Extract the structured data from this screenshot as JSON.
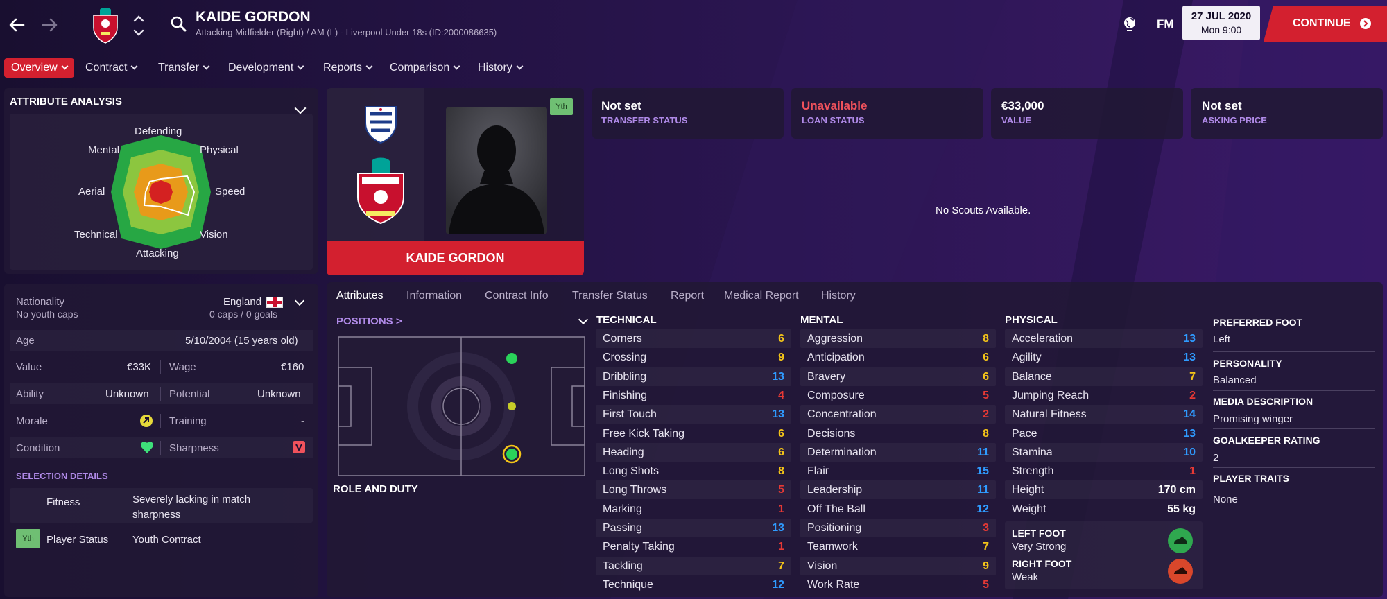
{
  "header": {
    "player_name": "KAIDE GORDON",
    "subtitle": "Attacking Midfielder (Right) / AM (L) - Liverpool Under 18s (ID:2000086635)",
    "fm_label": "FM",
    "date": "27 JUL 2020",
    "time": "Mon 9:00",
    "continue_label": "CONTINUE"
  },
  "nav_tabs": [
    {
      "label": "Overview"
    },
    {
      "label": "Contract"
    },
    {
      "label": "Transfer"
    },
    {
      "label": "Development"
    },
    {
      "label": "Reports"
    },
    {
      "label": "Comparison"
    },
    {
      "label": "History"
    }
  ],
  "attribute_analysis": {
    "title": "ATTRIBUTE ANALYSIS",
    "axes": [
      "Defending",
      "Physical",
      "Speed",
      "Vision",
      "Attacking",
      "Technical",
      "Aerial",
      "Mental"
    ]
  },
  "profile_card": {
    "youth_badge": "Yth",
    "name_banner": "KAIDE GORDON"
  },
  "status_cards": [
    {
      "value": "Not set",
      "label": "TRANSFER STATUS",
      "value_color": "#ffffff"
    },
    {
      "value": "Unavailable",
      "label": "LOAN STATUS",
      "value_color": "#f0525c"
    },
    {
      "value": "€33,000",
      "label": "VALUE",
      "value_color": "#ffffff"
    },
    {
      "value": "Not set",
      "label": "ASKING PRICE",
      "value_color": "#ffffff"
    }
  ],
  "scouts_message": "No Scouts Available.",
  "info": {
    "nationality_label": "Nationality",
    "nationality_value": "England",
    "youth_caps": "No youth caps",
    "caps": "0 caps / 0 goals",
    "age_label": "Age",
    "age_value": "5/10/2004 (15 years old)",
    "value_label": "Value",
    "value_value": "€33K",
    "wage_label": "Wage",
    "wage_value": "€160",
    "ability_label": "Ability",
    "ability_value": "Unknown",
    "potential_label": "Potential",
    "potential_value": "Unknown",
    "morale_label": "Morale",
    "training_label": "Training",
    "training_value": "-",
    "condition_label": "Condition",
    "sharpness_label": "Sharpness"
  },
  "selection": {
    "title": "SELECTION DETAILS",
    "fitness_label": "Fitness",
    "fitness_value_line1": "Severely lacking in match",
    "fitness_value_line2": "sharpness",
    "yth_badge": "Yth",
    "status_label": "Player Status",
    "status_value": "Youth Contract"
  },
  "sub_tabs": [
    "Attributes",
    "Information",
    "Contract Info",
    "Transfer Status",
    "Report",
    "Medical Report",
    "History"
  ],
  "positions": {
    "title": "POSITIONS >",
    "role_title": "ROLE AND DUTY"
  },
  "technical": {
    "title": "TECHNICAL",
    "items": [
      {
        "name": "Corners",
        "value": "6"
      },
      {
        "name": "Crossing",
        "value": "9"
      },
      {
        "name": "Dribbling",
        "value": "13"
      },
      {
        "name": "Finishing",
        "value": "4"
      },
      {
        "name": "First Touch",
        "value": "13"
      },
      {
        "name": "Free Kick Taking",
        "value": "6"
      },
      {
        "name": "Heading",
        "value": "6"
      },
      {
        "name": "Long Shots",
        "value": "8"
      },
      {
        "name": "Long Throws",
        "value": "5"
      },
      {
        "name": "Marking",
        "value": "1"
      },
      {
        "name": "Passing",
        "value": "13"
      },
      {
        "name": "Penalty Taking",
        "value": "1"
      },
      {
        "name": "Tackling",
        "value": "7"
      },
      {
        "name": "Technique",
        "value": "12"
      }
    ]
  },
  "mental": {
    "title": "MENTAL",
    "items": [
      {
        "name": "Aggression",
        "value": "8"
      },
      {
        "name": "Anticipation",
        "value": "6"
      },
      {
        "name": "Bravery",
        "value": "6"
      },
      {
        "name": "Composure",
        "value": "5"
      },
      {
        "name": "Concentration",
        "value": "2"
      },
      {
        "name": "Decisions",
        "value": "8"
      },
      {
        "name": "Determination",
        "value": "11"
      },
      {
        "name": "Flair",
        "value": "15"
      },
      {
        "name": "Leadership",
        "value": "11"
      },
      {
        "name": "Off The Ball",
        "value": "12"
      },
      {
        "name": "Positioning",
        "value": "3"
      },
      {
        "name": "Teamwork",
        "value": "7"
      },
      {
        "name": "Vision",
        "value": "9"
      },
      {
        "name": "Work Rate",
        "value": "5"
      }
    ]
  },
  "physical": {
    "title": "PHYSICAL",
    "items": [
      {
        "name": "Acceleration",
        "value": "13"
      },
      {
        "name": "Agility",
        "value": "13"
      },
      {
        "name": "Balance",
        "value": "7"
      },
      {
        "name": "Jumping Reach",
        "value": "2"
      },
      {
        "name": "Natural Fitness",
        "value": "14"
      },
      {
        "name": "Pace",
        "value": "13"
      },
      {
        "name": "Stamina",
        "value": "10"
      },
      {
        "name": "Strength",
        "value": "1"
      },
      {
        "name": "Height",
        "value": "170 cm"
      },
      {
        "name": "Weight",
        "value": "55 kg"
      }
    ],
    "left_foot_label": "LEFT FOOT",
    "left_foot_value": "Very Strong",
    "right_foot_label": "RIGHT FOOT",
    "right_foot_value": "Weak"
  },
  "side_info": [
    {
      "label": "PREFERRED FOOT",
      "value": "Left"
    },
    {
      "label": "PERSONALITY",
      "value": "Balanced"
    },
    {
      "label": "MEDIA DESCRIPTION",
      "value": "Promising winger"
    },
    {
      "label": "GOALKEEPER RATING",
      "value": "2"
    },
    {
      "label": "PLAYER TRAITS",
      "value": "None"
    }
  ],
  "colors": {
    "accent_red": "#d3202f",
    "purple_label": "#b08ae8",
    "value_red": "#e53935",
    "value_orange": "#ff9800",
    "value_yellow": "#f5c518",
    "value_blue": "#2f9bff",
    "yth_green": "#6fbf73"
  }
}
